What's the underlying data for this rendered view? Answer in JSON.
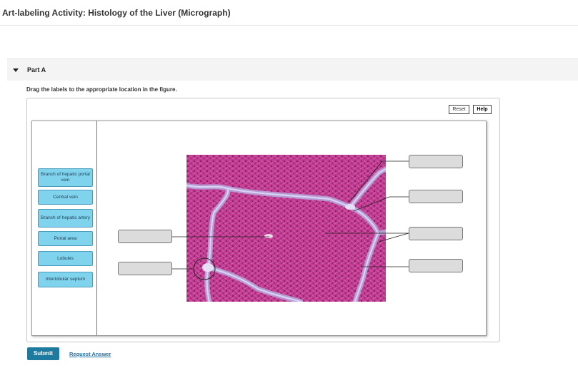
{
  "page": {
    "title": "Art-labeling Activity: Histology of the Liver (Micrograph)"
  },
  "part": {
    "label": "Part A",
    "instruction": "Drag the labels to the appropriate location in the figure."
  },
  "toolbar": {
    "reset_label": "Reset",
    "help_label": "Help"
  },
  "labels": [
    "Branch of hepatic portal vein",
    "Central vein",
    "Branch of hepatic artery",
    "Portal area",
    "Lobules",
    "Interlobular septum"
  ],
  "actions": {
    "submit_label": "Submit",
    "request_label": "Request Answer"
  },
  "colors": {
    "accent": "#1f7a9f",
    "label_fill": "#7fd3ec",
    "drop_target": "#dcdcdc"
  }
}
